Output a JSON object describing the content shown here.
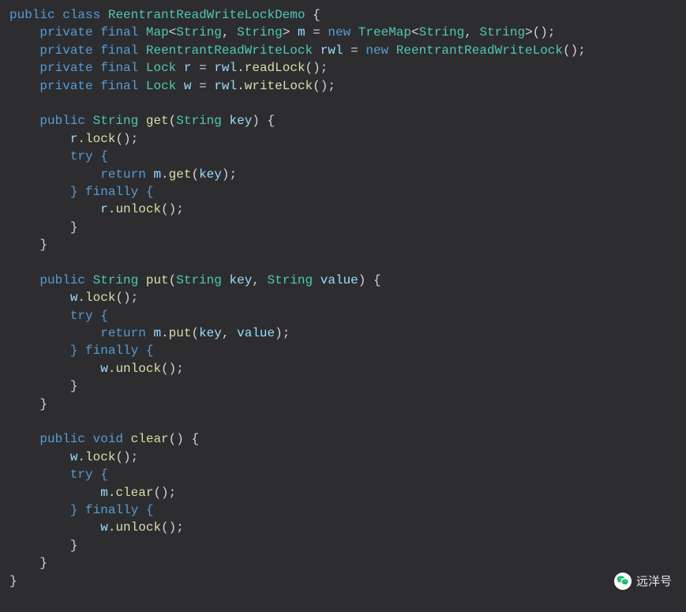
{
  "code": {
    "line1": {
      "public": "public",
      "class": "class",
      "className": "ReentrantReadWriteLockDemo",
      "brace": "{"
    },
    "line2": {
      "private": "private",
      "final": "final",
      "Map": "Map",
      "lt1": "<",
      "String1": "String",
      "comma1": ",",
      "String2": "String",
      "gt1": ">",
      "var": "m",
      "eq": "=",
      "new": "new",
      "TreeMap": "TreeMap",
      "lt2": "<",
      "String3": "String",
      "comma2": ",",
      "String4": "String",
      "gt2": ">",
      "parens": "()",
      "semi": ";"
    },
    "line3": {
      "private": "private",
      "final": "final",
      "type": "ReentrantReadWriteLock",
      "var": "rwl",
      "eq": "=",
      "new": "new",
      "ctor": "ReentrantReadWriteLock",
      "parens": "()",
      "semi": ";"
    },
    "line4": {
      "private": "private",
      "final": "final",
      "Lock": "Lock",
      "var": "r",
      "eq": "=",
      "rwl": "rwl",
      "dot": ".",
      "method": "readLock",
      "parens": "()",
      "semi": ";"
    },
    "line5": {
      "private": "private",
      "final": "final",
      "Lock": "Lock",
      "var": "w",
      "eq": "=",
      "rwl": "rwl",
      "dot": ".",
      "method": "writeLock",
      "parens": "()",
      "semi": ";"
    },
    "get": {
      "sig": {
        "public": "public",
        "ret": "String",
        "name": "get",
        "lp": "(",
        "ptype": "String",
        "pname": "key",
        "rp": ")",
        "brace": "{"
      },
      "lock": {
        "obj": "r",
        "dot": ".",
        "method": "lock",
        "parens": "()",
        "semi": ";"
      },
      "try": "try {",
      "ret": {
        "return": "return",
        "obj": "m",
        "dot": ".",
        "method": "get",
        "lp": "(",
        "arg": "key",
        "rp": ")",
        "semi": ";"
      },
      "finally": "} finally {",
      "unlock": {
        "obj": "r",
        "dot": ".",
        "method": "unlock",
        "parens": "()",
        "semi": ";"
      },
      "close1": "}",
      "close2": "}"
    },
    "put": {
      "sig": {
        "public": "public",
        "ret": "String",
        "name": "put",
        "lp": "(",
        "ptype1": "String",
        "pname1": "key",
        "comma": ",",
        "ptype2": "String",
        "pname2": "value",
        "rp": ")",
        "brace": "{"
      },
      "lock": {
        "obj": "w",
        "dot": ".",
        "method": "lock",
        "parens": "()",
        "semi": ";"
      },
      "try": "try {",
      "ret": {
        "return": "return",
        "obj": "m",
        "dot": ".",
        "method": "put",
        "lp": "(",
        "arg1": "key",
        "comma": ",",
        "arg2": "value",
        "rp": ")",
        "semi": ";"
      },
      "finally": "} finally {",
      "unlock": {
        "obj": "w",
        "dot": ".",
        "method": "unlock",
        "parens": "()",
        "semi": ";"
      },
      "close1": "}",
      "close2": "}"
    },
    "clear": {
      "sig": {
        "public": "public",
        "ret": "void",
        "name": "clear",
        "lp": "(",
        "rp": ")",
        "brace": "{"
      },
      "lock": {
        "obj": "w",
        "dot": ".",
        "method": "lock",
        "parens": "()",
        "semi": ";"
      },
      "try": "try {",
      "body": {
        "obj": "m",
        "dot": ".",
        "method": "clear",
        "parens": "()",
        "semi": ";"
      },
      "finally": "} finally {",
      "unlock": {
        "obj": "w",
        "dot": ".",
        "method": "unlock",
        "parens": "()",
        "semi": ";"
      },
      "close1": "}",
      "close2": "}"
    },
    "end": "}"
  },
  "watermark": "远洋号"
}
